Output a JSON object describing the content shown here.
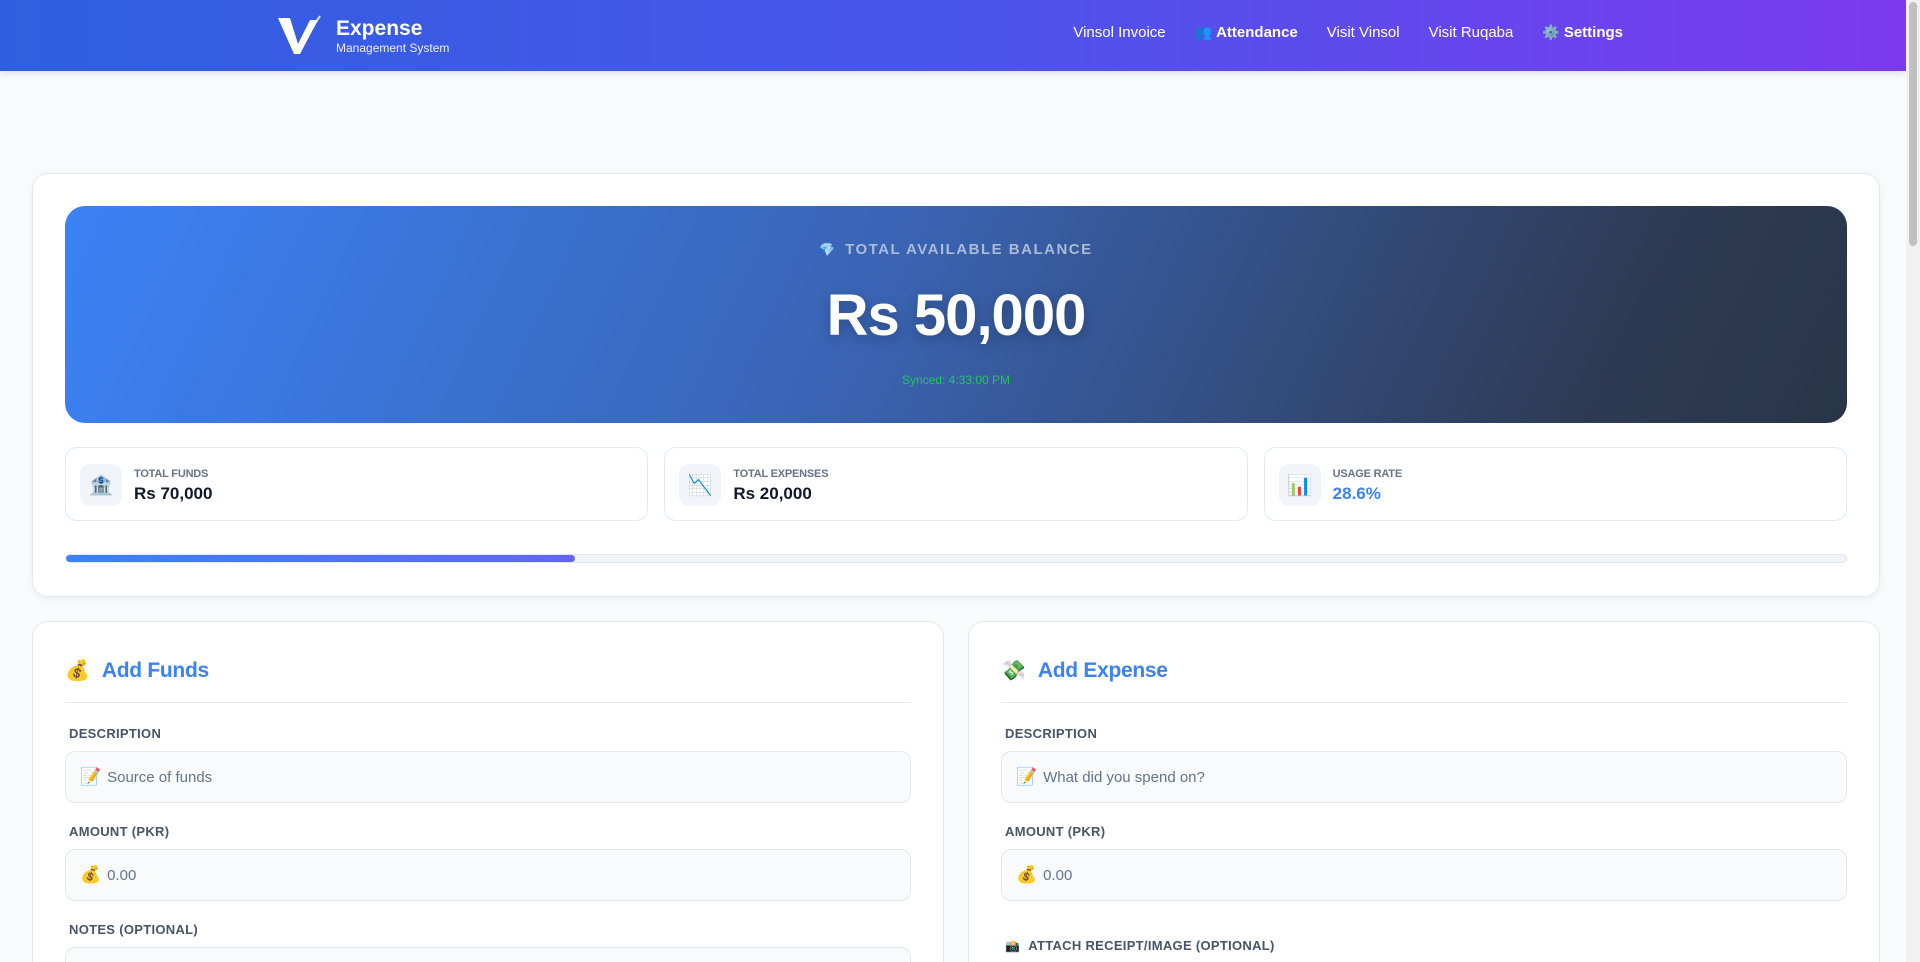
{
  "header": {
    "brand_title": "Expense",
    "brand_subtitle": "Management System",
    "nav": [
      {
        "label": "Vinsol Invoice",
        "icon": ""
      },
      {
        "label": "Attendance",
        "icon": "👥"
      },
      {
        "label": "Visit Vinsol",
        "icon": ""
      },
      {
        "label": "Visit Ruqaba",
        "icon": ""
      },
      {
        "label": "Settings",
        "icon": "⚙️"
      }
    ]
  },
  "balance": {
    "icon": "💎",
    "label": "TOTAL AVAILABLE BALANCE",
    "amount": "Rs 50,000",
    "synced": "Synced: 4:33:00 PM"
  },
  "stats": [
    {
      "icon": "🏦",
      "label": "TOTAL FUNDS",
      "value": "Rs 70,000"
    },
    {
      "icon": "📉",
      "label": "TOTAL EXPENSES",
      "value": "Rs 20,000"
    },
    {
      "icon": "📊",
      "label": "USAGE RATE",
      "value": "28.6%"
    }
  ],
  "usage_progress": 0.286,
  "add_funds": {
    "icon": "💰",
    "title": "Add Funds",
    "description_label": "DESCRIPTION",
    "description_icon": "📝",
    "description_placeholder": "Source of funds",
    "amount_label": "AMOUNT (PKR)",
    "amount_icon": "💰",
    "amount_placeholder": "0.00",
    "notes_label": "NOTES (OPTIONAL)"
  },
  "add_expense": {
    "icon": "💸",
    "title": "Add Expense",
    "description_label": "DESCRIPTION",
    "description_icon": "📝",
    "description_placeholder": "What did you spend on?",
    "amount_label": "AMOUNT (PKR)",
    "amount_icon": "💰",
    "amount_placeholder": "0.00",
    "attach_icon": "📸",
    "attach_label": "ATTACH RECEIPT/IMAGE (OPTIONAL)"
  },
  "colors": {
    "accent": "#3b82f6",
    "header_start": "#2f5fe0",
    "header_end": "#7c3aed",
    "synced": "#22c55e"
  }
}
